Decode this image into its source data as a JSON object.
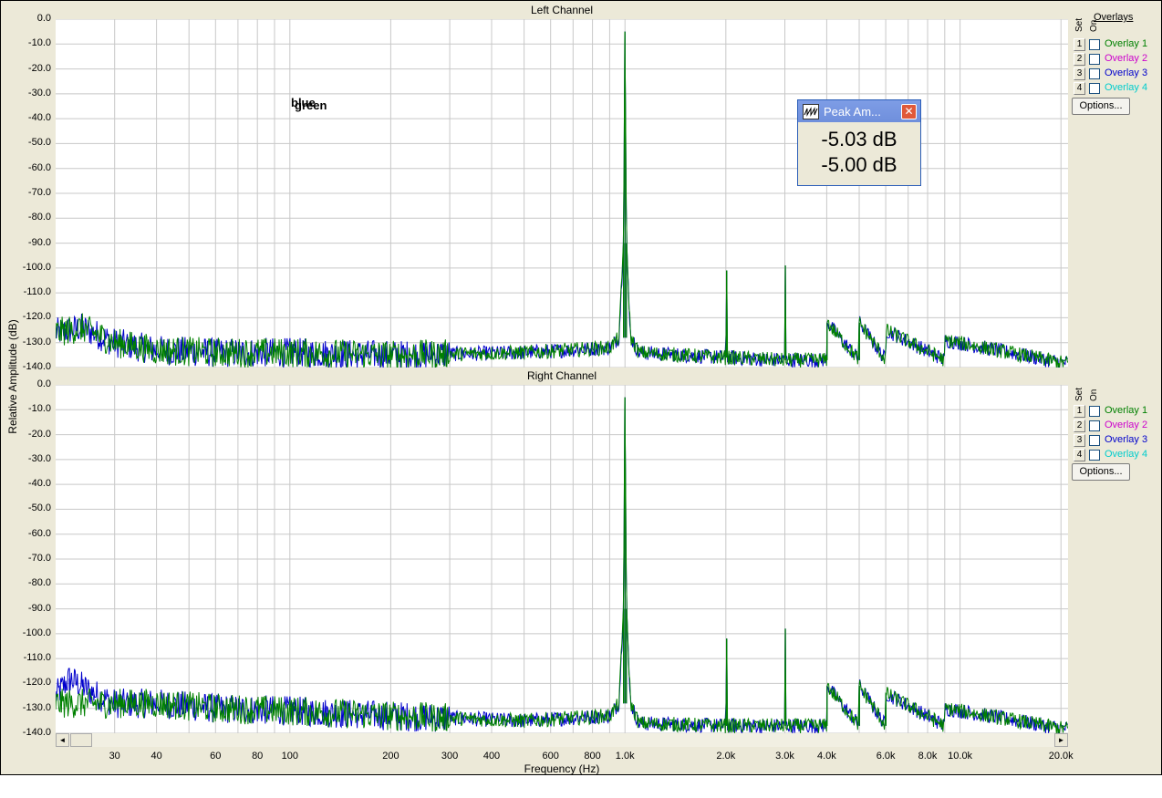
{
  "chart_data": [
    {
      "type": "line",
      "title": "Left Channel",
      "xlabel": "Frequency (Hz)",
      "ylabel": "Relative Amplitude (dB)",
      "x_scale": "log",
      "xlim": [
        20,
        21000
      ],
      "ylim": [
        -140,
        0
      ],
      "y_ticks": [
        "0.0",
        "-10.0",
        "-20.0",
        "-30.0",
        "-40.0",
        "-50.0",
        "-60.0",
        "-70.0",
        "-80.0",
        "-90.0",
        "-100.0",
        "-110.0",
        "-120.0",
        "-130.0",
        "-140.0"
      ],
      "x_ticks": [
        {
          "value": 30,
          "label": "30"
        },
        {
          "value": 40,
          "label": "40"
        },
        {
          "value": 60,
          "label": "60"
        },
        {
          "value": 80,
          "label": "80"
        },
        {
          "value": 100,
          "label": "100"
        },
        {
          "value": 200,
          "label": "200"
        },
        {
          "value": 300,
          "label": "300"
        },
        {
          "value": 400,
          "label": "400"
        },
        {
          "value": 600,
          "label": "600"
        },
        {
          "value": 800,
          "label": "800"
        },
        {
          "value": 1000,
          "label": "1.0k"
        },
        {
          "value": 2000,
          "label": "2.0k"
        },
        {
          "value": 3000,
          "label": "3.0k"
        },
        {
          "value": 4000,
          "label": "4.0k"
        },
        {
          "value": 6000,
          "label": "6.0k"
        },
        {
          "value": 8000,
          "label": "8.0k"
        },
        {
          "value": 10000,
          "label": "10.0k"
        },
        {
          "value": 20000,
          "label": "20.0k"
        }
      ],
      "grid": true,
      "series": [
        {
          "color": "#0000cc",
          "noise_floor": -133,
          "points": [
            [
              20,
              -126
            ],
            [
              24,
              -124
            ],
            [
              30,
              -130
            ],
            [
              40,
              -133
            ],
            [
              60,
              -134
            ],
            [
              100,
              -134
            ],
            [
              200,
              -135
            ],
            [
              500,
              -134
            ],
            [
              900,
              -132
            ],
            [
              960,
              -128
            ],
            [
              990,
              -90
            ],
            [
              1000,
              -5.0
            ],
            [
              1010,
              -90
            ],
            [
              1040,
              -128
            ],
            [
              1100,
              -134
            ],
            [
              2000,
              -136
            ],
            [
              2010,
              -101
            ],
            [
              2020,
              -136
            ],
            [
              3000,
              -137
            ],
            [
              3010,
              -99
            ],
            [
              3020,
              -137
            ],
            [
              4000,
              -137
            ],
            [
              4010,
              -122
            ],
            [
              5000,
              -137
            ],
            [
              5010,
              -122
            ],
            [
              6000,
              -137
            ],
            [
              6010,
              -125
            ],
            [
              9000,
              -137
            ],
            [
              9010,
              -129
            ],
            [
              20000,
              -138
            ]
          ]
        },
        {
          "color": "#008000",
          "noise_floor": -132,
          "points": [
            [
              20,
              -126
            ],
            [
              24,
              -124
            ],
            [
              30,
              -130
            ],
            [
              40,
              -133
            ],
            [
              60,
              -134
            ],
            [
              100,
              -134
            ],
            [
              200,
              -135
            ],
            [
              500,
              -134
            ],
            [
              900,
              -132
            ],
            [
              960,
              -128
            ],
            [
              990,
              -90
            ],
            [
              1000,
              -5.03
            ],
            [
              1010,
              -90
            ],
            [
              1040,
              -128
            ],
            [
              1100,
              -134
            ],
            [
              2000,
              -136
            ],
            [
              2010,
              -101
            ],
            [
              2020,
              -136
            ],
            [
              3000,
              -137
            ],
            [
              3010,
              -99
            ],
            [
              3020,
              -137
            ],
            [
              4000,
              -137
            ],
            [
              4010,
              -122
            ],
            [
              5000,
              -137
            ],
            [
              5010,
              -122
            ],
            [
              6000,
              -137
            ],
            [
              6010,
              -125
            ],
            [
              9000,
              -137
            ],
            [
              9010,
              -129
            ],
            [
              20000,
              -138
            ]
          ]
        }
      ],
      "annotations": [
        "blue",
        "green"
      ]
    },
    {
      "type": "line",
      "title": "Right Channel",
      "xlabel": "Frequency (Hz)",
      "ylabel": "Relative Amplitude (dB)",
      "x_scale": "log",
      "xlim": [
        20,
        21000
      ],
      "ylim": [
        -140,
        0
      ],
      "y_ticks": [
        "0.0",
        "-10.0",
        "-20.0",
        "-30.0",
        "-40.0",
        "-50.0",
        "-60.0",
        "-70.0",
        "-80.0",
        "-90.0",
        "-100.0",
        "-110.0",
        "-120.0",
        "-130.0",
        "-140.0"
      ],
      "grid": true,
      "series": [
        {
          "color": "#0000cc",
          "noise_floor": -133,
          "points": [
            [
              20,
              -125
            ],
            [
              22,
              -118
            ],
            [
              26,
              -124
            ],
            [
              30,
              -128
            ],
            [
              40,
              -128
            ],
            [
              60,
              -130
            ],
            [
              100,
              -131
            ],
            [
              200,
              -133
            ],
            [
              500,
              -135
            ],
            [
              900,
              -133
            ],
            [
              960,
              -128
            ],
            [
              990,
              -90
            ],
            [
              1000,
              -5.0
            ],
            [
              1010,
              -90
            ],
            [
              1040,
              -128
            ],
            [
              1100,
              -136
            ],
            [
              2000,
              -137
            ],
            [
              2010,
              -102
            ],
            [
              2020,
              -137
            ],
            [
              3000,
              -137
            ],
            [
              3010,
              -98
            ],
            [
              3020,
              -137
            ],
            [
              4000,
              -137
            ],
            [
              4010,
              -121
            ],
            [
              5000,
              -137
            ],
            [
              5010,
              -121
            ],
            [
              6000,
              -137
            ],
            [
              6010,
              -124
            ],
            [
              9000,
              -137
            ],
            [
              9010,
              -130
            ],
            [
              20000,
              -138
            ]
          ]
        },
        {
          "color": "#008000",
          "noise_floor": -131,
          "points": [
            [
              20,
              -128
            ],
            [
              30,
              -128
            ],
            [
              40,
              -128
            ],
            [
              60,
              -130
            ],
            [
              100,
              -131
            ],
            [
              200,
              -133
            ],
            [
              500,
              -135
            ],
            [
              900,
              -133
            ],
            [
              960,
              -128
            ],
            [
              990,
              -90
            ],
            [
              1000,
              -5.03
            ],
            [
              1010,
              -90
            ],
            [
              1040,
              -128
            ],
            [
              1100,
              -136
            ],
            [
              2000,
              -137
            ],
            [
              2010,
              -102
            ],
            [
              2020,
              -137
            ],
            [
              3000,
              -137
            ],
            [
              3010,
              -98
            ],
            [
              3020,
              -137
            ],
            [
              4000,
              -137
            ],
            [
              4010,
              -121
            ],
            [
              5000,
              -137
            ],
            [
              5010,
              -121
            ],
            [
              6000,
              -137
            ],
            [
              6010,
              -124
            ],
            [
              9000,
              -137
            ],
            [
              9010,
              -130
            ],
            [
              20000,
              -138
            ]
          ]
        }
      ]
    }
  ],
  "overlays": {
    "header": "Overlays",
    "set_label": "Set",
    "on_label": "On",
    "options_label": "Options...",
    "items": [
      {
        "num": "1",
        "name": "Overlay 1",
        "color": "#008000"
      },
      {
        "num": "2",
        "name": "Overlay 2",
        "color": "#cc00cc"
      },
      {
        "num": "3",
        "name": "Overlay 3",
        "color": "#0000cc"
      },
      {
        "num": "4",
        "name": "Overlay 4",
        "color": "#00cccc"
      }
    ]
  },
  "peak_window": {
    "title": "Peak Am...",
    "value_1": "-5.03 dB",
    "value_2": "-5.00 dB"
  },
  "scrollbar": {
    "left_arrow": "◄",
    "right_arrow": "►"
  }
}
